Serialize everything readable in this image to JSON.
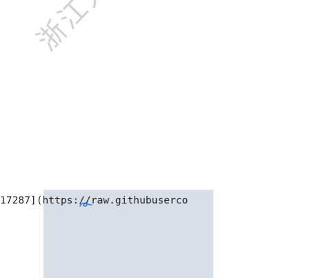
{
  "watermark": {
    "text": "浙江大学"
  },
  "editor": {
    "code_line": "17287](https://raw.githubuserco"
  },
  "colors": {
    "selection_background": "#d9dfe7",
    "text": "#222222",
    "watermark": "#c9c9c9",
    "cursor_annotation": "#2f6fd6"
  },
  "icons": {
    "cursor_annotation": "pen-scribble-icon"
  }
}
